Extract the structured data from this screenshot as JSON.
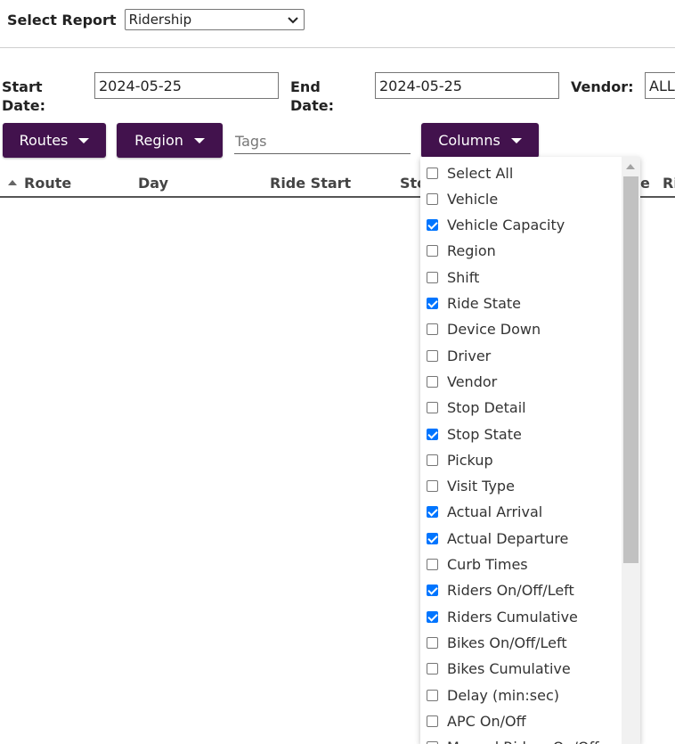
{
  "report": {
    "label": "Select Report",
    "selected": "Ridership"
  },
  "filters": {
    "start_date_label_1": "Start",
    "start_date_label_2": "Date:",
    "start_date_value": "2024-05-25",
    "end_date_label_1": "End",
    "end_date_label_2": "Date:",
    "end_date_value": "2024-05-25",
    "vendor_label": "Vendor:",
    "vendor_value": "ALL"
  },
  "toolbar": {
    "routes_label": "Routes",
    "region_label": "Region",
    "tags_placeholder": "Tags",
    "columns_label": "Columns"
  },
  "table": {
    "headers": [
      "Route",
      "Day",
      "Ride Start",
      "Sto",
      "e",
      "Ri"
    ]
  },
  "columns_menu": {
    "items": [
      {
        "label": "Select All",
        "checked": false
      },
      {
        "label": "Vehicle",
        "checked": false
      },
      {
        "label": "Vehicle Capacity",
        "checked": true
      },
      {
        "label": "Region",
        "checked": false
      },
      {
        "label": "Shift",
        "checked": false
      },
      {
        "label": "Ride State",
        "checked": true
      },
      {
        "label": "Device Down",
        "checked": false
      },
      {
        "label": "Driver",
        "checked": false
      },
      {
        "label": "Vendor",
        "checked": false
      },
      {
        "label": "Stop Detail",
        "checked": false
      },
      {
        "label": "Stop State",
        "checked": true
      },
      {
        "label": "Pickup",
        "checked": false
      },
      {
        "label": "Visit Type",
        "checked": false
      },
      {
        "label": "Actual Arrival",
        "checked": true
      },
      {
        "label": "Actual Departure",
        "checked": true
      },
      {
        "label": "Curb Times",
        "checked": false
      },
      {
        "label": "Riders On/Off/Left",
        "checked": true
      },
      {
        "label": "Riders Cumulative",
        "checked": true
      },
      {
        "label": "Bikes On/Off/Left",
        "checked": false
      },
      {
        "label": "Bikes Cumulative",
        "checked": false
      },
      {
        "label": "Delay (min:sec)",
        "checked": false
      },
      {
        "label": "APC On/Off",
        "checked": false
      },
      {
        "label": "Manual Riders On/Off",
        "checked": false
      }
    ]
  },
  "colors": {
    "button_bg": "#42124d",
    "checkbox_checked": "#0075ff"
  }
}
